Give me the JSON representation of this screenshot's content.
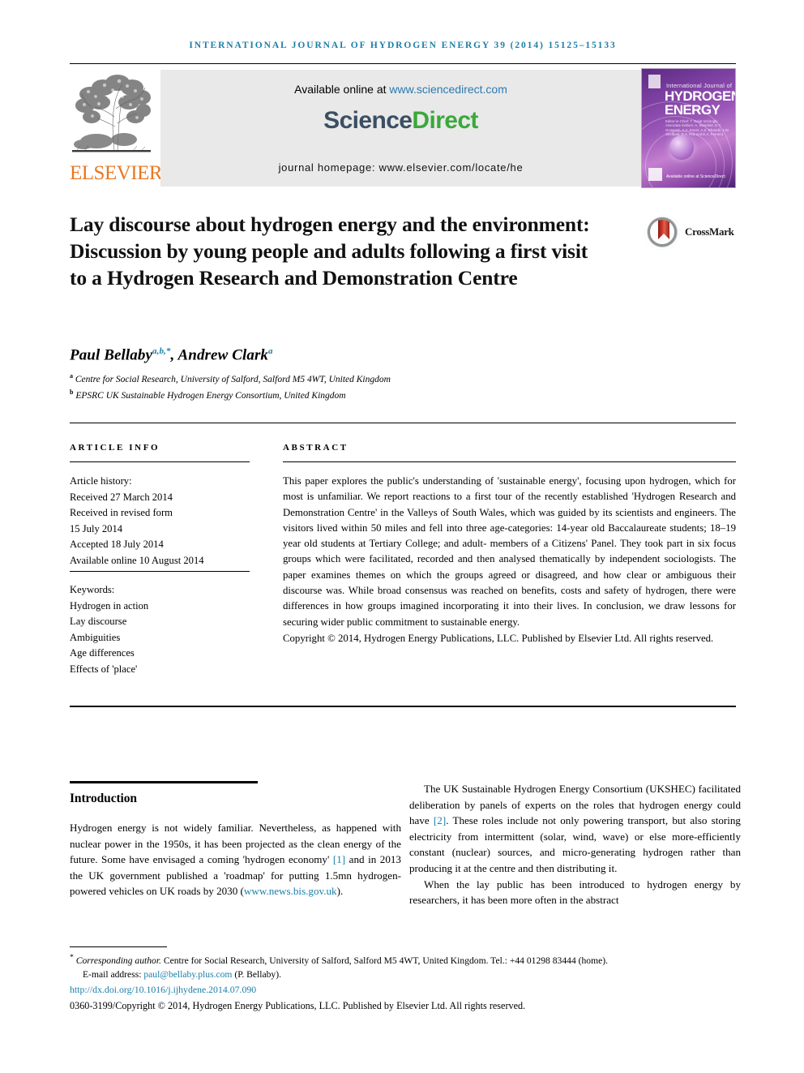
{
  "running_head": "International Journal of Hydrogen Energy 39 (2014) 15125–15133",
  "masthead": {
    "publisher_name": "ELSEVIER",
    "available_text": "Available online at ",
    "sciencedirect_url": "www.sciencedirect.com",
    "sciencedirect_logo_part1": "Science",
    "sciencedirect_logo_part2": "Direct",
    "journal_homepage": "journal homepage: www.elsevier.com/locate/he",
    "cover": {
      "line_small": "International Journal of",
      "line_big_1": "HYDROGEN",
      "line_big_2": "ENERGY",
      "editors": "Editor-in-Chief: T. Nejat Veziroglu   Associate Editors: A. Steinfeld, D.Y. Goswami, A.A. Evers, A.Z. Rhandir, J.W. Sheffield, D.A. Poli and E.A. Ferreira",
      "sciencedirect_tag": "Available online at ScienceDirect"
    }
  },
  "article": {
    "title": "Lay discourse about hydrogen energy and the environment: Discussion by young people and adults following a first visit to a Hydrogen Research and Demonstration Centre",
    "crossmark_label": "CrossMark",
    "authors": [
      {
        "name": "Paul Bellaby",
        "marks": "a,b,*"
      },
      {
        "name": "Andrew Clark",
        "marks": "a"
      }
    ],
    "affiliations": [
      {
        "mark": "a",
        "text": "Centre for Social Research, University of Salford, Salford M5 4WT, United Kingdom"
      },
      {
        "mark": "b",
        "text": "EPSRC UK Sustainable Hydrogen Energy Consortium, United Kingdom"
      }
    ]
  },
  "article_info": {
    "heading": "ARTICLE INFO",
    "history_label": "Article history:",
    "history": [
      "Received 27 March 2014",
      "Received in revised form",
      "15 July 2014",
      "Accepted 18 July 2014",
      "Available online 10 August 2014"
    ],
    "keywords_label": "Keywords:",
    "keywords": [
      "Hydrogen in action",
      "Lay discourse",
      "Ambiguities",
      "Age differences",
      "Effects of 'place'"
    ]
  },
  "abstract": {
    "heading": "ABSTRACT",
    "text": "This paper explores the public's understanding of 'sustainable energy', focusing upon hydrogen, which for most is unfamiliar. We report reactions to a first tour of the recently established 'Hydrogen Research and Demonstration Centre' in the Valleys of South Wales, which was guided by its scientists and engineers. The visitors lived within 50 miles and fell into three age-categories: 14-year old Baccalaureate students; 18–19 year old students at Tertiary College; and adult- members of a Citizens' Panel. They took part in six focus groups which were facilitated, recorded and then analysed thematically by independent sociologists. The paper examines themes on which the groups agreed or disagreed, and how clear or ambiguous their discourse was. While broad consensus was reached on benefits, costs and safety of hydrogen, there were differences in how groups imagined incorporating it into their lives. In conclusion, we draw lessons for securing wider public commitment to sustainable energy.",
    "copyright": "Copyright © 2014, Hydrogen Energy Publications, LLC. Published by Elsevier Ltd. All rights reserved."
  },
  "body": {
    "section_heading": "Introduction",
    "left_para_1_a": "Hydrogen energy is not widely familiar. Nevertheless, as happened with nuclear power in the 1950s, it has been projected as the clean energy of the future. Some have envisaged a coming 'hydrogen economy' ",
    "left_para_1_ref": "[1]",
    "left_para_1_b": " and in 2013 the UK government published a 'roadmap' for putting 1.5mn hydrogen-powered vehicles on UK roads by 2030 (",
    "left_para_1_link": "www.news.bis.gov.uk",
    "left_para_1_c": ").",
    "right_para_1_a": "The UK Sustainable Hydrogen Energy Consortium (UKSHEC) facilitated deliberation by panels of experts on the roles that hydrogen energy could have ",
    "right_para_1_ref": "[2]",
    "right_para_1_b": ". These roles include not only powering transport, but also storing electricity from intermittent (solar, wind, wave) or else more-efficiently constant (nuclear) sources, and micro-generating hydrogen rather than producing it at the centre and then distributing it.",
    "right_para_2": "When the lay public has been introduced to hydrogen energy by researchers, it has been more often in the abstract"
  },
  "footnotes": {
    "corresponding_mark": "*",
    "corresponding_label": "Corresponding author.",
    "corresponding_text": " Centre for Social Research, University of Salford, Salford M5 4WT, United Kingdom. Tel.: +44 01298 83444 (home).",
    "email_label": "E-mail address: ",
    "email_address": "paul@bellaby.plus.com",
    "email_suffix": " (P. Bellaby).",
    "doi": "http://dx.doi.org/10.1016/j.ijhydene.2014.07.090",
    "issn_line": "0360-3199/Copyright © 2014, Hydrogen Energy Publications, LLC. Published by Elsevier Ltd. All rights reserved."
  },
  "colors": {
    "link_blue": "#1a7fa8",
    "elsevier_orange": "#E87722",
    "sciencedirect_green": "#3aa93a",
    "sciencedirect_navy": "#3b4f63",
    "banner_gray": "#e9e9e9"
  }
}
